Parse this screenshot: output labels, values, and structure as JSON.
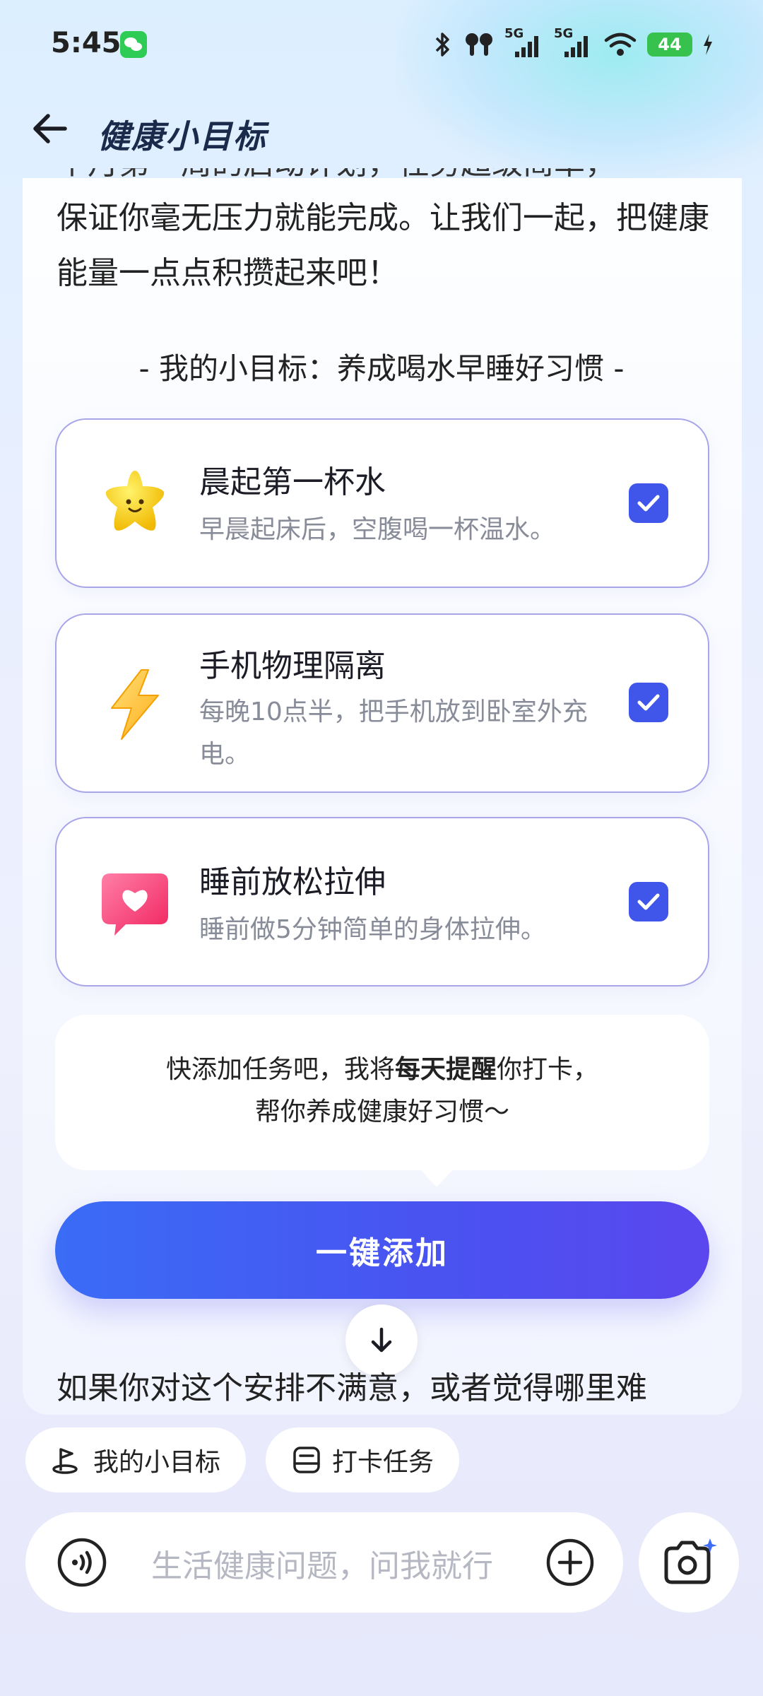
{
  "status_bar": {
    "time": "5:45",
    "battery": "44",
    "network_1": "5G",
    "network_2": "5G"
  },
  "header": {
    "title": "健康小目标"
  },
  "intro": {
    "partial_line": "个月第一周的启动计划，任务超级简单，",
    "text": "保证你毫无压力就能完成。让我们一起，把健康能量一点点积攒起来吧！"
  },
  "goal_heading": "- 我的小目标：养成喝水早睡好习惯 -",
  "tasks": [
    {
      "title": "晨起第一杯水",
      "desc": "早晨起床后，空腹喝一杯温水。",
      "icon": "star-face-icon",
      "checked": true
    },
    {
      "title": "手机物理隔离",
      "desc": "每晚10点半，把手机放到卧室外充电。",
      "icon": "lightning-icon",
      "checked": true
    },
    {
      "title": "睡前放松拉伸",
      "desc": "睡前做5分钟简单的身体拉伸。",
      "icon": "heart-bubble-icon",
      "checked": true
    }
  ],
  "reminder": {
    "line1_a": "快添加任务吧，我将",
    "line1_bold": "每天提醒",
    "line1_b": "你打卡，",
    "line2": "帮你养成健康好习惯～"
  },
  "add_button_label": "一键添加",
  "trailing_text": "如果你对这个安排不满意，或者觉得哪里难",
  "chips": [
    {
      "label": "我的小目标",
      "icon": "goal-flag-icon"
    },
    {
      "label": "打卡任务",
      "icon": "checkin-task-icon"
    }
  ],
  "input": {
    "placeholder": "生活健康问题，问我就行"
  },
  "colors": {
    "accent": "#4056ea",
    "button_gradient_start": "#3a6cf6",
    "button_gradient_end": "#5a47ee",
    "card_border": "#a8a6e8"
  }
}
